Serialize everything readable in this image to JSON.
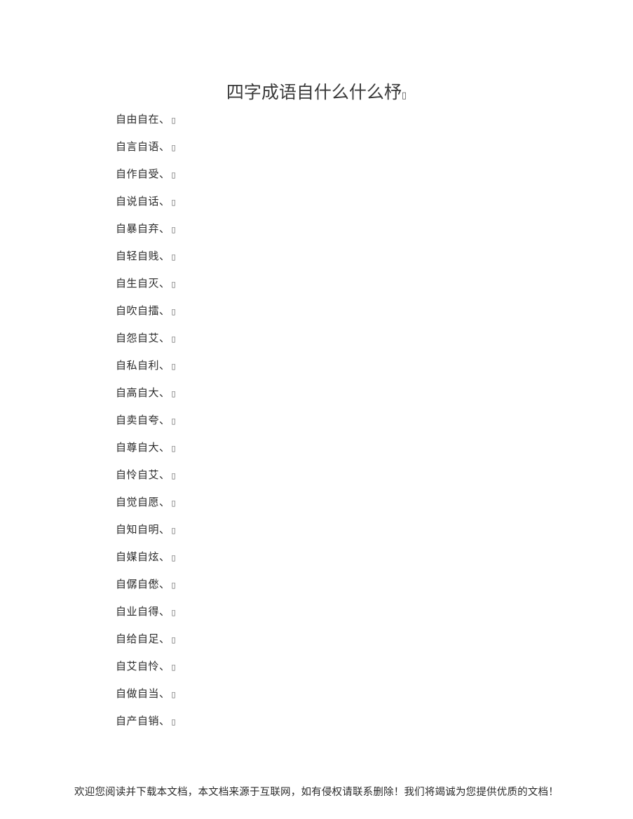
{
  "document": {
    "title": "四字成语自什么什么杼",
    "title_trailing_mark": "▯",
    "item_trailing_mark": "▯",
    "background_color": "#ffffff",
    "text_color": "#2b2b2b",
    "title_color": "#3a3a3a"
  },
  "idioms": [
    {
      "text": "自由自在、"
    },
    {
      "text": "自言自语、"
    },
    {
      "text": "自作自受、"
    },
    {
      "text": "自说自话、"
    },
    {
      "text": "自暴自弃、"
    },
    {
      "text": "自轻自贱、"
    },
    {
      "text": "自生自灭、"
    },
    {
      "text": "自吹自擂、"
    },
    {
      "text": "自怨自艾、"
    },
    {
      "text": "自私自利、"
    },
    {
      "text": "自高自大、"
    },
    {
      "text": "自卖自夸、"
    },
    {
      "text": "自尊自大、"
    },
    {
      "text": "自怜自艾、"
    },
    {
      "text": "自觉自愿、"
    },
    {
      "text": "自知自明、"
    },
    {
      "text": "自媒自炫、"
    },
    {
      "text": "自僝自僽、"
    },
    {
      "text": "自业自得、"
    },
    {
      "text": "自给自足、"
    },
    {
      "text": "自艾自怜、"
    },
    {
      "text": "自做自当、"
    },
    {
      "text": "自产自销、"
    }
  ],
  "footer": {
    "note": "欢迎您阅读并下载本文档，本文档来源于互联网，如有侵权请联系删除！我们将竭诚为您提供优质的文档！"
  }
}
